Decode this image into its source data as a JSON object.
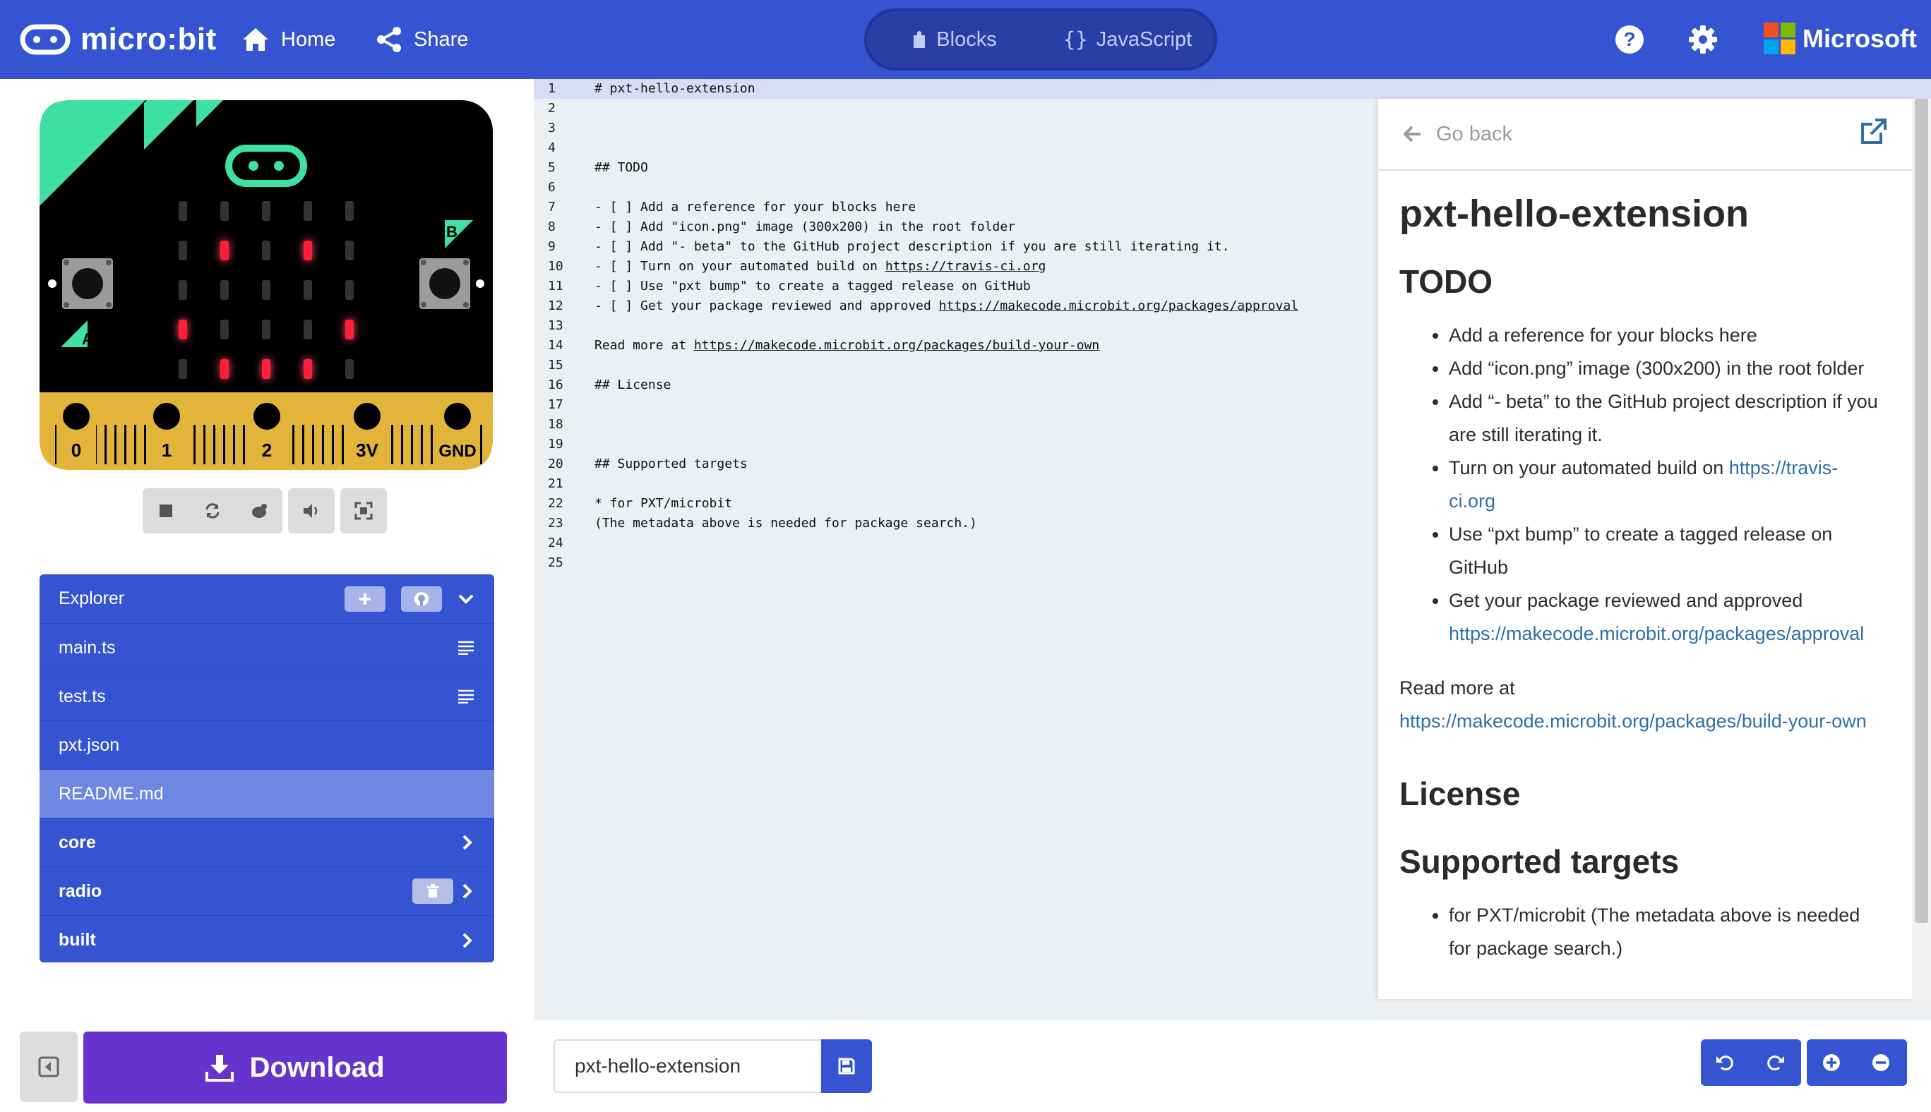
{
  "header": {
    "brand": "micro:bit",
    "home_label": "Home",
    "share_label": "Share",
    "blocks_label": "Blocks",
    "javascript_label": "JavaScript",
    "microsoft_label": "Microsoft"
  },
  "simulator": {
    "pins": [
      "0",
      "1",
      "2",
      "3V",
      "GND"
    ],
    "button_a": "A",
    "button_b": "B",
    "led_on": [
      [
        1,
        1
      ],
      [
        1,
        3
      ],
      [
        3,
        0
      ],
      [
        3,
        4
      ],
      [
        4,
        1
      ],
      [
        4,
        2
      ],
      [
        4,
        3
      ]
    ],
    "icons": [
      "stop-icon",
      "restart-icon",
      "debug-icon",
      "mute-icon",
      "fullscreen-icon"
    ]
  },
  "explorer": {
    "title": "Explorer",
    "files": [
      {
        "label": "main.ts",
        "kind": "file"
      },
      {
        "label": "test.ts",
        "kind": "file"
      },
      {
        "label": "pxt.json",
        "kind": "file"
      },
      {
        "label": "README.md",
        "kind": "file",
        "active": true
      },
      {
        "label": "core",
        "kind": "folder"
      },
      {
        "label": "radio",
        "kind": "folder"
      },
      {
        "label": "built",
        "kind": "folder"
      }
    ]
  },
  "download_label": "Download",
  "project_name": "pxt-hello-extension",
  "code_lines": [
    {
      "n": "1",
      "t": "# pxt-hello-extension"
    },
    {
      "n": "2",
      "t": ""
    },
    {
      "n": "3",
      "t": ""
    },
    {
      "n": "4",
      "t": ""
    },
    {
      "n": "5",
      "t": "## TODO"
    },
    {
      "n": "6",
      "t": ""
    },
    {
      "n": "7",
      "t": "- [ ] Add a reference for your blocks here"
    },
    {
      "n": "8",
      "t": "- [ ] Add \"icon.png\" image (300x200) in the root folder"
    },
    {
      "n": "9",
      "t": "- [ ] Add \"- beta\" to the GitHub project description if you are still iterating it."
    },
    {
      "n": "10",
      "t": "- [ ] Turn on your automated build on ",
      "link": "https://travis-ci.org"
    },
    {
      "n": "11",
      "t": "- [ ] Use \"pxt bump\" to create a tagged release on GitHub"
    },
    {
      "n": "12",
      "t": "- [ ] Get your package reviewed and approved ",
      "link": "https://makecode.microbit.org/packages/approval"
    },
    {
      "n": "13",
      "t": ""
    },
    {
      "n": "14",
      "t": "Read more at ",
      "link": "https://makecode.microbit.org/packages/build-your-own"
    },
    {
      "n": "15",
      "t": ""
    },
    {
      "n": "16",
      "t": "## License"
    },
    {
      "n": "17",
      "t": ""
    },
    {
      "n": "18",
      "t": ""
    },
    {
      "n": "19",
      "t": ""
    },
    {
      "n": "20",
      "t": "## Supported targets"
    },
    {
      "n": "21",
      "t": ""
    },
    {
      "n": "22",
      "t": "* for PXT/microbit"
    },
    {
      "n": "23",
      "t": "(The metadata above is needed for package search.)"
    },
    {
      "n": "24",
      "t": ""
    },
    {
      "n": "25",
      "t": ""
    }
  ],
  "doc": {
    "go_back": "Go back",
    "title": "pxt-hello-extension",
    "todo_heading": "TODO",
    "todo_items": [
      {
        "text": "Add a reference for your blocks here"
      },
      {
        "text": "Add “icon.png” image (300x200) in the root folder"
      },
      {
        "text": "Add “- beta” to the GitHub project description if you are still iterating it."
      },
      {
        "text": "Turn on your automated build on ",
        "link": "https://travis-ci.org"
      },
      {
        "text": "Use “pxt bump” to create a tagged release on GitHub"
      },
      {
        "text": "Get your package reviewed and approved ",
        "link": "https://makecode.microbit.org/packages/approval"
      }
    ],
    "read_more": "Read more at ",
    "read_more_link": "https://makecode.microbit.org/packages/build-your-own",
    "license_heading": "License",
    "targets_heading": "Supported targets",
    "targets_items": [
      "for PXT/microbit (The metadata above is needed for package search.)"
    ]
  },
  "colors": {
    "header": "#3454d1",
    "download": "#6633cc",
    "board_accent": "#3fe0a4",
    "led": "#ff1e3a",
    "pin_gold": "#e2b53a"
  }
}
